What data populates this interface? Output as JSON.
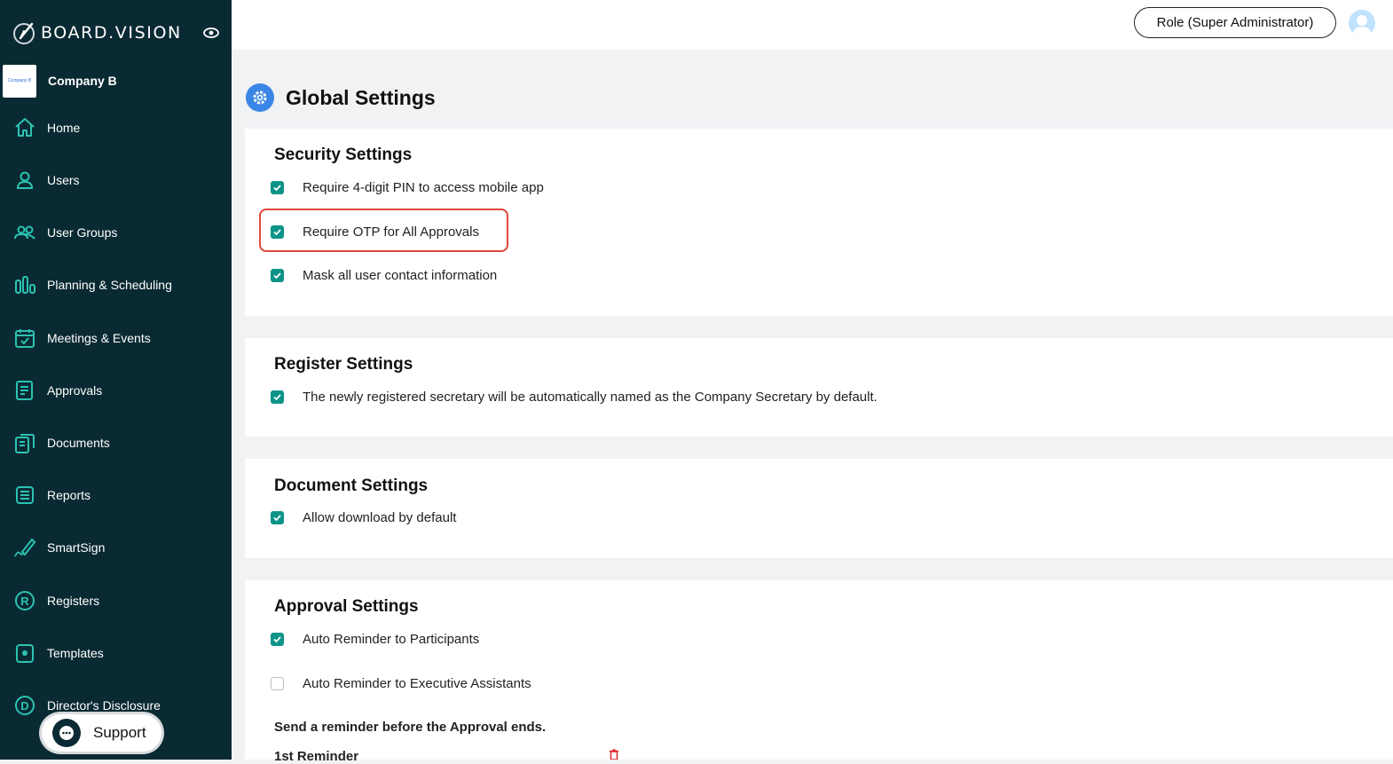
{
  "brand": {
    "name": "BOARD.VISION"
  },
  "company": {
    "name": "Company B",
    "logo_text": "Company B"
  },
  "nav": [
    {
      "label": "Home",
      "icon": "home-icon"
    },
    {
      "label": "Users",
      "icon": "user-icon"
    },
    {
      "label": "User Groups",
      "icon": "users-icon"
    },
    {
      "label": "Planning & Scheduling",
      "icon": "planning-icon"
    },
    {
      "label": "Meetings & Events",
      "icon": "calendar-icon"
    },
    {
      "label": "Approvals",
      "icon": "approvals-icon"
    },
    {
      "label": "Documents",
      "icon": "documents-icon"
    },
    {
      "label": "Reports",
      "icon": "reports-icon"
    },
    {
      "label": "SmartSign",
      "icon": "pen-icon"
    },
    {
      "label": "Registers",
      "icon": "registered-icon"
    },
    {
      "label": "Templates",
      "icon": "template-icon"
    },
    {
      "label": "Director's Disclosure",
      "icon": "disclosure-icon"
    }
  ],
  "support": {
    "label": "Support"
  },
  "header": {
    "role": "Role (Super Administrator)"
  },
  "page": {
    "title": "Global Settings"
  },
  "sections": {
    "security": {
      "title": "Security Settings",
      "options": [
        {
          "label": "Require 4-digit PIN to access mobile app",
          "checked": true
        },
        {
          "label": "Require OTP for All Approvals",
          "checked": true
        },
        {
          "label": "Mask all user contact information",
          "checked": true
        }
      ]
    },
    "register": {
      "title": "Register Settings",
      "options": [
        {
          "label": "The newly registered secretary will be automatically named as the Company Secretary by default.",
          "checked": true
        }
      ]
    },
    "document": {
      "title": "Document Settings",
      "options": [
        {
          "label": "Allow download by default",
          "checked": true
        }
      ]
    },
    "approval": {
      "title": "Approval Settings",
      "options": [
        {
          "label": "Auto Reminder to Participants",
          "checked": true
        },
        {
          "label": "Auto Reminder to Executive Assistants",
          "checked": false
        }
      ],
      "reminder_heading": "Send a reminder before the Approval ends.",
      "first_reminder": "1st Reminder"
    }
  },
  "colors": {
    "sidebar": "#0a2a33",
    "accent": "#0d9488",
    "highlight": "#e0483a",
    "gear": "#3a86e6"
  }
}
